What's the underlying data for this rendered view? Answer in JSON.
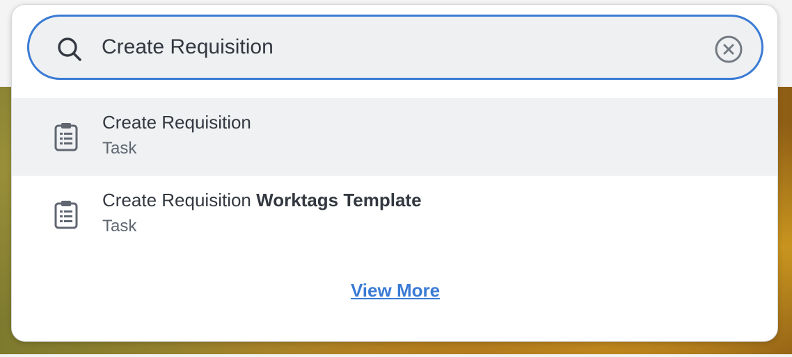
{
  "search": {
    "value": "Create Requisition",
    "placeholder": "",
    "icon": "search-icon",
    "clear_icon": "close-circle-icon",
    "border_color": "#3a7bd5"
  },
  "results": [
    {
      "title_plain": "Create Requisition",
      "title_bold": "",
      "category": "Task",
      "icon": "clipboard-icon",
      "highlighted": true
    },
    {
      "title_plain": "Create Requisition ",
      "title_bold": "Worktags Template",
      "category": "Task",
      "icon": "clipboard-icon",
      "highlighted": false
    }
  ],
  "view_more_label": "View More",
  "colors": {
    "accent": "#3a7bd5",
    "highlight_row": "#eff1f3",
    "text": "#333840",
    "subtext": "#5f6670"
  }
}
